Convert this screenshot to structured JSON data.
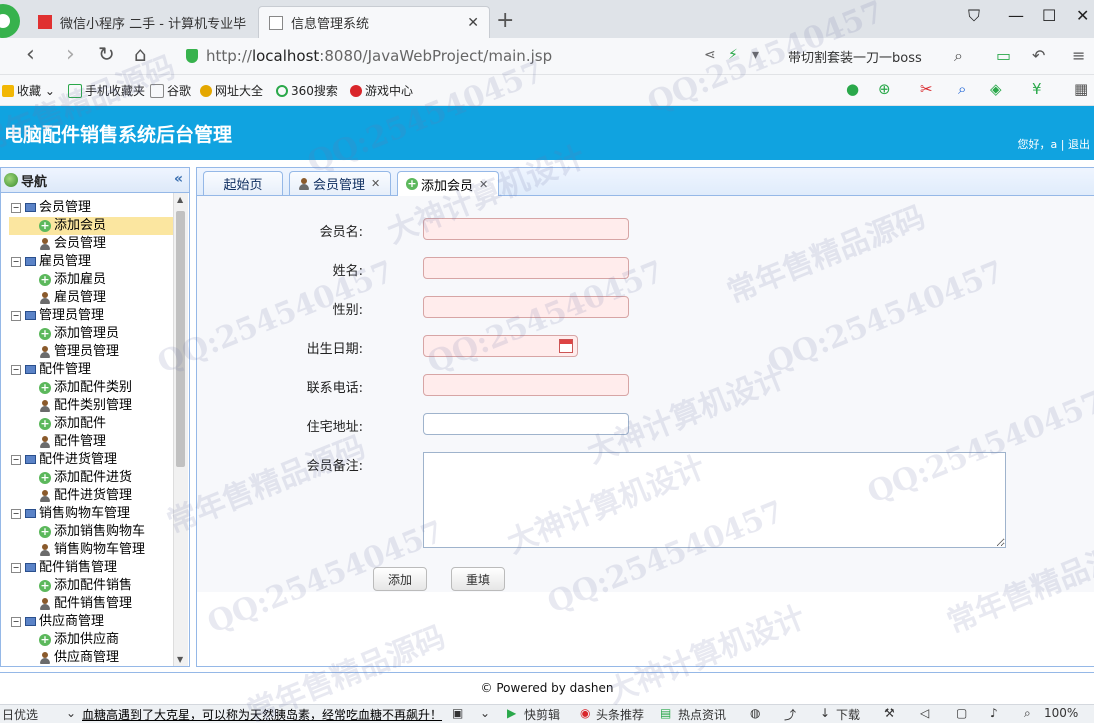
{
  "browser": {
    "tabs": [
      {
        "title": "微信小程序 二手 - 计算机专业毕",
        "active": false
      },
      {
        "title": "信息管理系统",
        "active": true
      }
    ],
    "url_prefix": "http://",
    "url_host": "localhost",
    "url_rest": ":8080/JavaWebProject/main.jsp",
    "search_text": "带切割套装一刀一boss",
    "bookmarks": [
      "收藏",
      "手机收藏夹",
      "谷歌",
      "网址大全",
      "360搜索",
      "游戏中心"
    ]
  },
  "app": {
    "title": "电脑配件销售系统后台管理",
    "greeting": "您好，a",
    "separator": "|",
    "logout": "退出"
  },
  "sidebar": {
    "title": "导航",
    "collapse_glyph": "«",
    "groups": [
      {
        "label": "会员管理",
        "items": [
          "添加会员",
          "会员管理"
        ]
      },
      {
        "label": "雇员管理",
        "items": [
          "添加雇员",
          "雇员管理"
        ]
      },
      {
        "label": "管理员管理",
        "items": [
          "添加管理员",
          "管理员管理"
        ]
      },
      {
        "label": "配件管理",
        "items": [
          "添加配件类别",
          "配件类别管理",
          "添加配件",
          "配件管理"
        ]
      },
      {
        "label": "配件进货管理",
        "items": [
          "添加配件进货",
          "配件进货管理"
        ]
      },
      {
        "label": "销售购物车管理",
        "items": [
          "添加销售购物车",
          "销售购物车管理"
        ]
      },
      {
        "label": "配件销售管理",
        "items": [
          "添加配件销售",
          "配件销售管理"
        ]
      },
      {
        "label": "供应商管理",
        "items": [
          "添加供应商",
          "供应商管理"
        ]
      }
    ],
    "selected": "添加会员"
  },
  "main": {
    "tabs": [
      {
        "label": "起始页",
        "closable": false
      },
      {
        "label": "会员管理",
        "closable": true
      },
      {
        "label": "添加会员",
        "closable": true,
        "active": true
      }
    ],
    "form": {
      "fields": [
        {
          "label": "会员名:",
          "value": ""
        },
        {
          "label": "姓名:",
          "value": ""
        },
        {
          "label": "性别:",
          "value": ""
        },
        {
          "label": "出生日期:",
          "value": ""
        },
        {
          "label": "联系电话:",
          "value": ""
        },
        {
          "label": "住宅地址:",
          "value": ""
        },
        {
          "label": "会员备注:",
          "value": ""
        }
      ],
      "buttons": {
        "submit": "添加",
        "reset": "重填"
      }
    }
  },
  "footer": {
    "text": "© Powered by dashen"
  },
  "statusbar": {
    "left": "日优选",
    "news": "血糖高遇到了大克星，可以称为天然胰岛素，经常吃血糖不再飙升！",
    "items": [
      "快剪辑",
      "头条推荐",
      "热点资讯",
      "下载"
    ],
    "zoom": "100%"
  },
  "watermarks": [
    "QQ:254540457",
    "大神计算机设计",
    "常年售精品源码"
  ]
}
